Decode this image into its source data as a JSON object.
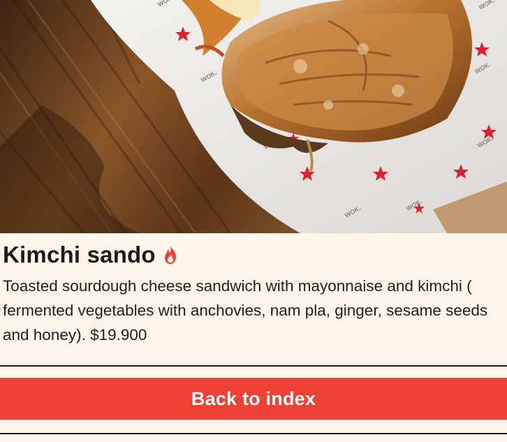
{
  "hero": {
    "image_label": "Kimchi sando photo",
    "wrapper_print": "WOK."
  },
  "dish": {
    "name": "Kimchi sando",
    "spicy_icon": "fire-icon",
    "description": "Toasted sourdough cheese sandwich with mayonnaise and kimchi ( fermented vegetables with anchovies, nam pla, ginger, sesame seeds and honey). $19.900"
  },
  "navigation": {
    "back_label": "Back to index"
  },
  "colors": {
    "background": "#fdf6e8",
    "accent": "#ee4035",
    "text": "#1b1b1b"
  }
}
